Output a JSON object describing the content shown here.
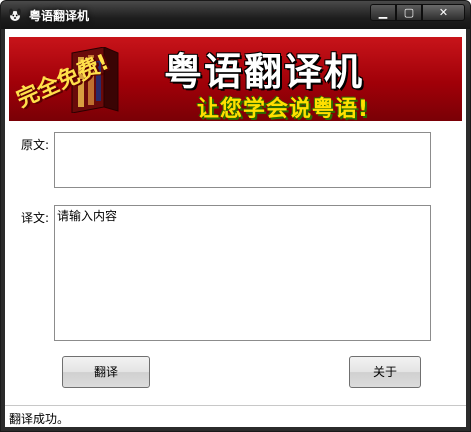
{
  "window": {
    "title": "粤语翻译机",
    "controls": {
      "minimize_glyph": "▁",
      "maximize_glyph": "▢",
      "close_glyph": "✕"
    },
    "app_icon": "dog-icon"
  },
  "banner": {
    "badge": "完全免费!",
    "title": "粤语翻译机",
    "slogan": "让您学会说粤语!",
    "colors": {
      "background": "#b0101a",
      "title": "#ffffff",
      "slogan": "#ffe000"
    }
  },
  "form": {
    "source_label": "原文:",
    "source_value": "",
    "target_label": "译文:",
    "target_value": "请输入内容"
  },
  "buttons": {
    "translate": "翻译",
    "about": "关于"
  },
  "status": {
    "text": "翻译成功。"
  }
}
